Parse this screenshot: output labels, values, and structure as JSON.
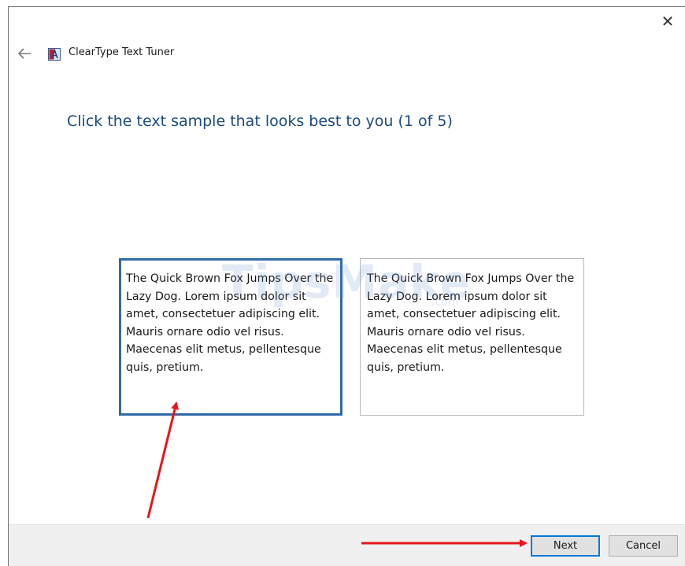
{
  "window": {
    "title": "ClearType Text Tuner",
    "close_symbol": "✕"
  },
  "heading": "Click the text sample that looks best to you (1 of 5)",
  "samples": [
    {
      "text": "The Quick Brown Fox Jumps Over the Lazy Dog. Lorem ipsum dolor sit amet, consectetuer adipiscing elit. Mauris ornare odio vel risus. Maecenas elit metus, pellentesque quis, pretium.",
      "selected": true
    },
    {
      "text": "The Quick Brown Fox Jumps Over the Lazy Dog. Lorem ipsum dolor sit amet, consectetuer adipiscing elit. Mauris ornare odio vel risus. Maecenas elit metus, pellentesque quis, pretium.",
      "selected": false
    }
  ],
  "watermark": {
    "main": "TipsMake",
    "sub": ".com"
  },
  "footer": {
    "next_label": "Next",
    "cancel_label": "Cancel"
  },
  "colors": {
    "accent": "#0078d7",
    "heading": "#1c4a7d",
    "selected_border": "#2e6aa9",
    "annotation_arrow": "#e8141c"
  },
  "icons": {
    "back": "back-arrow-icon",
    "app": "cleartype-app-icon",
    "close": "close-icon"
  }
}
